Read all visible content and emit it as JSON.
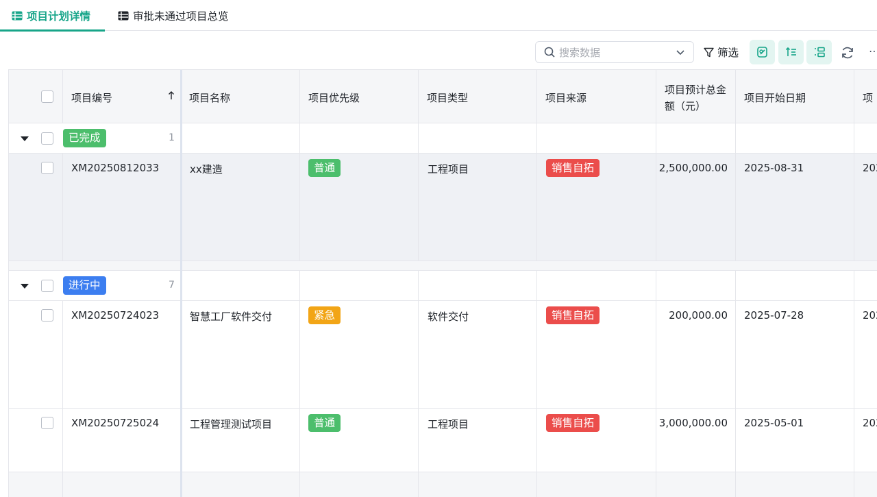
{
  "tabs": [
    {
      "label": "项目计划详情",
      "active": true,
      "icon": "table-icon"
    },
    {
      "label": "审批未通过项目总览",
      "active": false,
      "icon": "table-icon"
    }
  ],
  "toolbar": {
    "search_placeholder": "搜索数据",
    "filter_label": "筛选",
    "buttons": [
      "edit-note-icon",
      "sort-lines-icon",
      "group-list-icon",
      "refresh-icon",
      "more-icon"
    ]
  },
  "colors": {
    "accent": "#17a589",
    "green_tag": "#4cbe6c",
    "blue_tag": "#3c7ef0",
    "orange_tag": "#f2a516",
    "red_tag": "#eb4d4b"
  },
  "table": {
    "headers": [
      "项目编号",
      "项目名称",
      "项目优先级",
      "项目类型",
      "项目来源",
      "项目预计总金额（元）",
      "项目开始日期",
      "项"
    ],
    "groups": [
      {
        "label": "已完成",
        "count": "1",
        "rows": [
          {
            "code": "XM20250812033",
            "name": "xx建造",
            "priority": "普通",
            "type": "工程项目",
            "source": "销售自拓",
            "amount": "2,500,000.00",
            "start": "2025-08-31",
            "next": "202"
          }
        ]
      },
      {
        "label": "进行中",
        "count": "7",
        "rows": [
          {
            "code": "XM20250724023",
            "name": "智慧工厂软件交付",
            "priority": "紧急",
            "type": "软件交付",
            "source": "销售自拓",
            "amount": "200,000.00",
            "start": "2025-07-28",
            "next": "202"
          },
          {
            "code": "XM20250725024",
            "name": "工程管理测试项目",
            "priority": "普通",
            "type": "工程项目",
            "source": "销售自拓",
            "amount": "3,000,000.00",
            "start": "2025-05-01",
            "next": "202"
          }
        ]
      }
    ]
  }
}
